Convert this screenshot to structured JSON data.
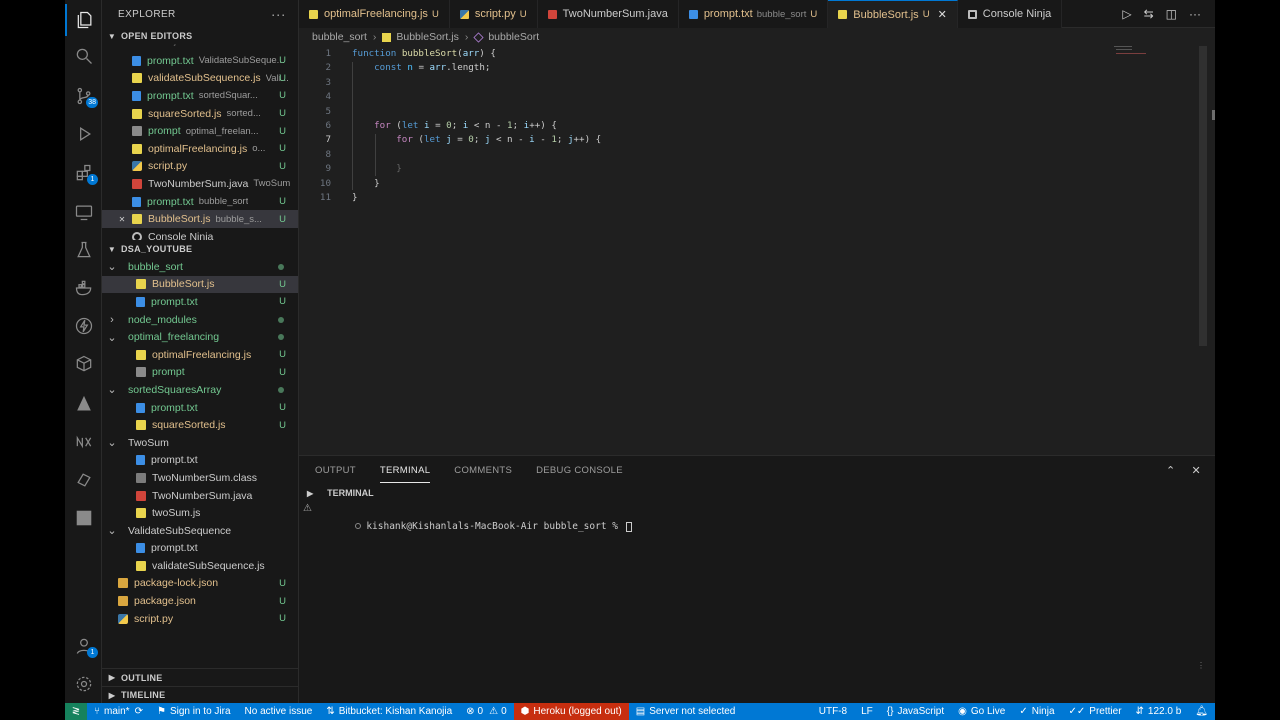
{
  "explorer": {
    "title": "EXPLORER",
    "open_editors_label": "OPEN EDITORS",
    "open_editors": [
      {
        "name": "prompt.txt",
        "sub": "ValidateSubSeque...",
        "icon": "txt",
        "status": "U",
        "cls": "mod"
      },
      {
        "name": "validateSubSequence.js",
        "sub": "Vali...",
        "icon": "js",
        "status": "U",
        "cls": ""
      },
      {
        "name": "prompt.txt",
        "sub": "sortedSquar...",
        "icon": "txt",
        "status": "U",
        "cls": "mod"
      },
      {
        "name": "squareSorted.js",
        "sub": "sorted...",
        "icon": "js",
        "status": "U",
        "cls": ""
      },
      {
        "name": "prompt",
        "sub": "optimal_freelan...",
        "icon": "plain",
        "status": "U",
        "cls": "mod"
      },
      {
        "name": "optimalFreelancing.js",
        "sub": "o...",
        "icon": "js",
        "status": "U",
        "cls": ""
      },
      {
        "name": "script.py",
        "sub": "",
        "icon": "py",
        "status": "U",
        "cls": ""
      },
      {
        "name": "TwoNumberSum.java",
        "sub": "TwoSum",
        "icon": "java",
        "status": "",
        "cls": "plain"
      },
      {
        "name": "prompt.txt",
        "sub": "bubble_sort",
        "icon": "txt",
        "status": "U",
        "cls": "mod"
      },
      {
        "name": "BubbleSort.js",
        "sub": "bubble_s...",
        "icon": "js",
        "status": "U",
        "cls": "",
        "active": true
      },
      {
        "name": "Console Ninja",
        "sub": "",
        "icon": "ninja",
        "status": "",
        "cls": "plain"
      }
    ],
    "workspace_label": "DSA_YOUTUBE",
    "tree": [
      {
        "name": "bubble_sort",
        "type": "folder",
        "open": true,
        "depth": 1,
        "dot": true
      },
      {
        "name": "BubbleSort.js",
        "type": "file",
        "icon": "js",
        "depth": 2,
        "status": "U",
        "selected": true
      },
      {
        "name": "prompt.txt",
        "type": "file",
        "icon": "txt",
        "depth": 2,
        "status": "U"
      },
      {
        "name": "node_modules",
        "type": "folder",
        "open": false,
        "depth": 1,
        "dot": true
      },
      {
        "name": "optimal_freelancing",
        "type": "folder",
        "open": true,
        "depth": 1,
        "dot": true
      },
      {
        "name": "optimalFreelancing.js",
        "type": "file",
        "icon": "js",
        "depth": 2,
        "status": "U"
      },
      {
        "name": "prompt",
        "type": "file",
        "icon": "plain",
        "depth": 2,
        "status": "U"
      },
      {
        "name": "sortedSquaresArray",
        "type": "folder",
        "open": true,
        "depth": 1,
        "dot": true
      },
      {
        "name": "prompt.txt",
        "type": "file",
        "icon": "txt",
        "depth": 2,
        "status": "U"
      },
      {
        "name": "squareSorted.js",
        "type": "file",
        "icon": "js",
        "depth": 2,
        "status": "U"
      },
      {
        "name": "TwoSum",
        "type": "folder",
        "open": true,
        "depth": 1,
        "dot": false
      },
      {
        "name": "prompt.txt",
        "type": "file",
        "icon": "txt",
        "depth": 2,
        "status": ""
      },
      {
        "name": "TwoNumberSum.class",
        "type": "file",
        "icon": "class",
        "depth": 2,
        "status": ""
      },
      {
        "name": "TwoNumberSum.java",
        "type": "file",
        "icon": "java",
        "depth": 2,
        "status": ""
      },
      {
        "name": "twoSum.js",
        "type": "file",
        "icon": "js",
        "depth": 2,
        "status": ""
      },
      {
        "name": "ValidateSubSequence",
        "type": "folder",
        "open": true,
        "depth": 1,
        "dot": false
      },
      {
        "name": "prompt.txt",
        "type": "file",
        "icon": "txt",
        "depth": 2,
        "status": ""
      },
      {
        "name": "validateSubSequence.js",
        "type": "file",
        "icon": "js",
        "depth": 2,
        "status": ""
      },
      {
        "name": "package-lock.json",
        "type": "file",
        "icon": "json",
        "depth": 1,
        "status": "U"
      },
      {
        "name": "package.json",
        "type": "file",
        "icon": "json",
        "depth": 1,
        "status": "U"
      },
      {
        "name": "script.py",
        "type": "file",
        "icon": "py",
        "depth": 1,
        "status": "U"
      }
    ],
    "outline_label": "OUTLINE",
    "timeline_label": "TIMELINE"
  },
  "tabs": [
    {
      "name": "optimalFreelancing.js",
      "icon": "js",
      "status": "U",
      "sub": ""
    },
    {
      "name": "script.py",
      "icon": "py",
      "status": "U",
      "sub": ""
    },
    {
      "name": "TwoNumberSum.java",
      "icon": "java",
      "status": "",
      "sub": ""
    },
    {
      "name": "prompt.txt",
      "icon": "txt",
      "status": "U",
      "sub": "bubble_sort"
    },
    {
      "name": "BubbleSort.js",
      "icon": "js",
      "status": "U",
      "sub": "",
      "active": true
    },
    {
      "name": "Console Ninja",
      "icon": "ninja",
      "status": "",
      "sub": ""
    }
  ],
  "breadcrumb": {
    "folder": "bubble_sort",
    "file": "BubbleSort.js",
    "symbol": "bubbleSort"
  },
  "editor": {
    "current_line": 7,
    "lines": [
      {
        "n": 1,
        "text": "function bubbleSort(arr) {"
      },
      {
        "n": 2,
        "text": "    const n = arr.length;"
      },
      {
        "n": 3,
        "text": ""
      },
      {
        "n": 4,
        "text": ""
      },
      {
        "n": 5,
        "text": ""
      },
      {
        "n": 6,
        "text": "    for (let i = 0; i < n - 1; i++) {"
      },
      {
        "n": 7,
        "text": "        for (let j = 0; j < n - i - 1; j++) {"
      },
      {
        "n": 8,
        "text": ""
      },
      {
        "n": 9,
        "text": "        }"
      },
      {
        "n": 10,
        "text": "    }"
      },
      {
        "n": 11,
        "text": "}"
      }
    ]
  },
  "panel": {
    "tabs": [
      "OUTPUT",
      "TERMINAL",
      "COMMENTS",
      "DEBUG CONSOLE"
    ],
    "active_tab": "TERMINAL",
    "terminal_title": "TERMINAL",
    "prompt": "kishank@Kishanlals-MacBook-Air bubble_sort % "
  },
  "status": {
    "branch": "main*",
    "jira": "Sign in to Jira",
    "issue": "No active issue",
    "bitbucket": "Bitbucket: Kishan Kanojia",
    "errors": "0",
    "warnings": "0",
    "heroku": "Heroku (logged out)",
    "server": "Server not selected",
    "encoding": "UTF-8",
    "eol": "LF",
    "language": "JavaScript",
    "golive": "Go Live",
    "ninja": "Ninja",
    "prettier": "Prettier",
    "size": "122.0 b"
  },
  "badges": {
    "scm": "38",
    "extensions": "1",
    "accounts": "1"
  },
  "colors": {
    "accent": "#0078d4",
    "untracked": "#73c991",
    "modified": "#e2c08d",
    "heroku": "#c72e0f"
  }
}
